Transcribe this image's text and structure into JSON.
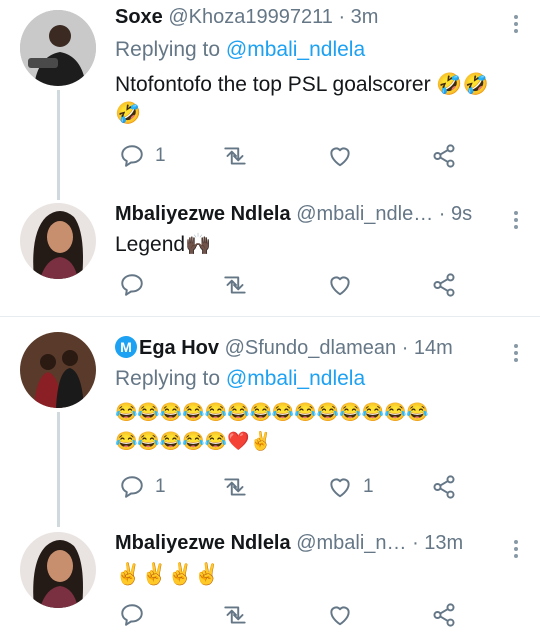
{
  "tweets": [
    {
      "name": "Soxe",
      "handle": "@Khoza19997211",
      "time": "· 3m",
      "replying_label": "Replying to",
      "replying_to": "@mbali_ndlela",
      "text": "Ntofontofo the top PSL goalscorer 🤣🤣\n🤣",
      "reply_count": "1",
      "retweet_count": "",
      "like_count": ""
    },
    {
      "name": "Mbaliyezwe Ndlela",
      "handle": "@mbali_ndle…",
      "time": "· 9s",
      "text": "Legend🙌🏿",
      "reply_count": "",
      "retweet_count": "",
      "like_count": ""
    },
    {
      "name_prefix": "M",
      "name": "Ega Hov",
      "handle": "@Sfundo_dlamean",
      "time": "· 14m",
      "replying_label": "Replying to",
      "replying_to": "@mbali_ndlela",
      "text": "😂😂😂😂😂😂😂😂😂😂😂😂😂😂\n😂😂😂😂😂❤️✌️",
      "reply_count": "1",
      "retweet_count": "",
      "like_count": "1"
    },
    {
      "name": "Mbaliyezwe Ndlela",
      "handle": "@mbali_n…",
      "time": "· 13m",
      "text": "✌️✌️✌️✌️",
      "reply_count": "",
      "retweet_count": "",
      "like_count": ""
    }
  ],
  "icons": {
    "reply": "reply-icon",
    "retweet": "retweet-icon",
    "like": "heart-icon",
    "share": "share-icon",
    "more": "more-icon"
  },
  "colors": {
    "link": "#1da1f2",
    "muted": "#657786",
    "thread_line": "#cfd9de"
  }
}
